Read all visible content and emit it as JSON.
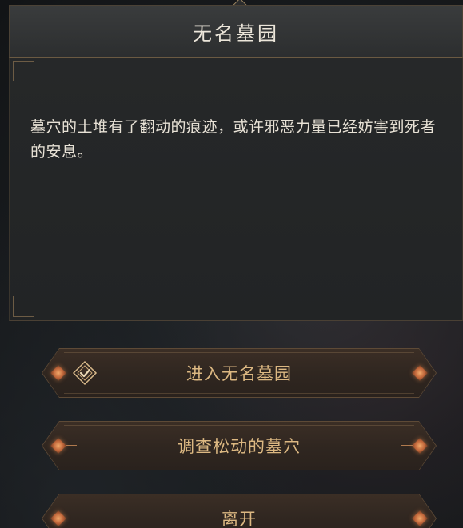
{
  "dialog": {
    "title": "无名墓园",
    "description": "墓穴的土堆有了翻动的痕迹，或许邪恶力量已经妨害到死者的安息。"
  },
  "options": [
    {
      "label": "进入无名墓园",
      "icon": "check-diamond-icon"
    },
    {
      "label": "调查松动的墓穴"
    },
    {
      "label": "离开"
    }
  ],
  "colors": {
    "title_text": "#ece6da",
    "option_text": "#dcb882",
    "gem_accent": "#e08a52"
  }
}
